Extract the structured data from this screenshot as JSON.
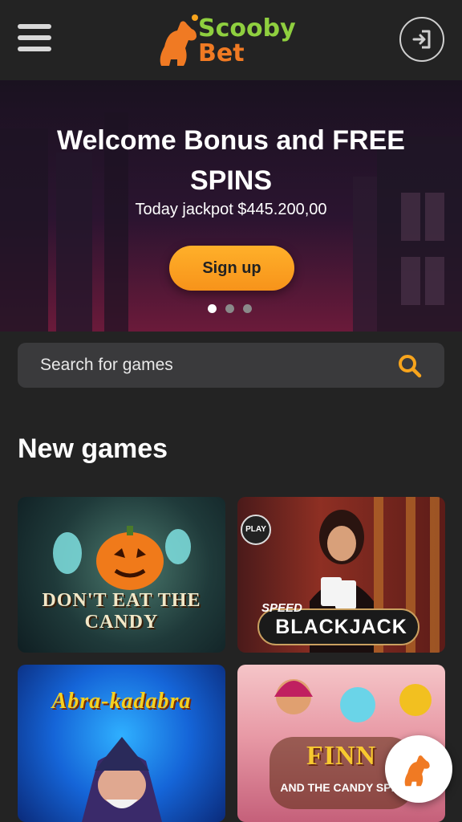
{
  "header": {
    "brand_line1": "Scooby",
    "brand_line2": "Bet",
    "menu_icon": "hamburger-menu-icon",
    "login_icon": "sign-in-icon"
  },
  "hero": {
    "title": "Welcome Bonus and FREE SPINS",
    "jackpot_text": "Today jackpot $445.200,00",
    "cta_label": "Sign up",
    "slides_total": 3,
    "active_slide": 1
  },
  "search": {
    "placeholder": "Search for games",
    "icon": "search-icon"
  },
  "sections": {
    "new_games_title": "New games"
  },
  "games": [
    {
      "title": "DON'T EAT THE CANDY"
    },
    {
      "badge": "PLAY",
      "pre_title": "SPEED",
      "title": "BLACKJACK"
    },
    {
      "title": "Abra-kadabra"
    },
    {
      "title": "FINN",
      "subtitle": "AND THE CANDY SPIN"
    }
  ],
  "colors": {
    "brand_green": "#8fcf3f",
    "brand_orange": "#f07a23",
    "cta": "#f7931a",
    "background": "#232323",
    "search_bg": "#3a3a3c",
    "search_icon": "#f7a41c"
  }
}
